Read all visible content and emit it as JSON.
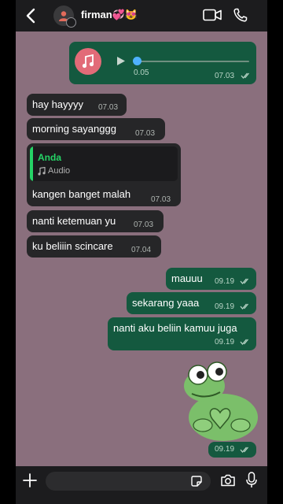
{
  "header": {
    "contact_name": "firman💞😻",
    "icons": [
      "back-chevron-icon",
      "avatar",
      "video-call-icon",
      "voice-call-icon"
    ]
  },
  "audio_message": {
    "duration": "0.05",
    "time": "07.03",
    "progress": 0.0
  },
  "incoming": [
    {
      "text": "hay hayyyy",
      "time": "07.03"
    },
    {
      "text": "morning sayanggg",
      "time": "07.03"
    },
    {
      "quote_name": "Anda",
      "quote_type": "Audio",
      "text": "kangen banget malah",
      "time": "07.03"
    },
    {
      "text": "nanti ketemuan yu",
      "time": "07.03"
    },
    {
      "text": "ku beliiin scincare",
      "time": "07.04"
    }
  ],
  "outgoing": [
    {
      "text": "mauuu",
      "time": "09.19"
    },
    {
      "text": "sekarang yaaa",
      "time": "09.19"
    },
    {
      "text": "nanti aku beliin kamuu juga",
      "time": "09.19"
    }
  ],
  "sticker": {
    "time": "09.19"
  },
  "input_bar": {
    "value": "",
    "placeholder": ""
  },
  "colors": {
    "chat_background": "#8a6f7d",
    "incoming_bubble": "#262628",
    "outgoing_bubble": "#14593f",
    "accent_green": "#25d366",
    "read_tick": "#b8d4c6"
  }
}
